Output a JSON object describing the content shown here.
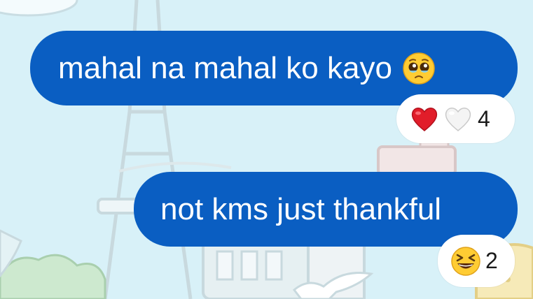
{
  "messages": [
    {
      "text": "mahal na mahal ko kayo",
      "emoji_icon": "pleading-face-icon",
      "reactions": {
        "icons": [
          "red-heart-icon",
          "white-heart-icon"
        ],
        "count": "4"
      }
    },
    {
      "text": "not kms just thankful",
      "reactions": {
        "icons": [
          "grinning-squinting-face-icon"
        ],
        "count": "2"
      }
    }
  ],
  "colors": {
    "bubble": "#0a5ec2",
    "bubble_text": "#ffffff",
    "background": "#d8f1f8",
    "reaction_pill": "#ffffff"
  }
}
